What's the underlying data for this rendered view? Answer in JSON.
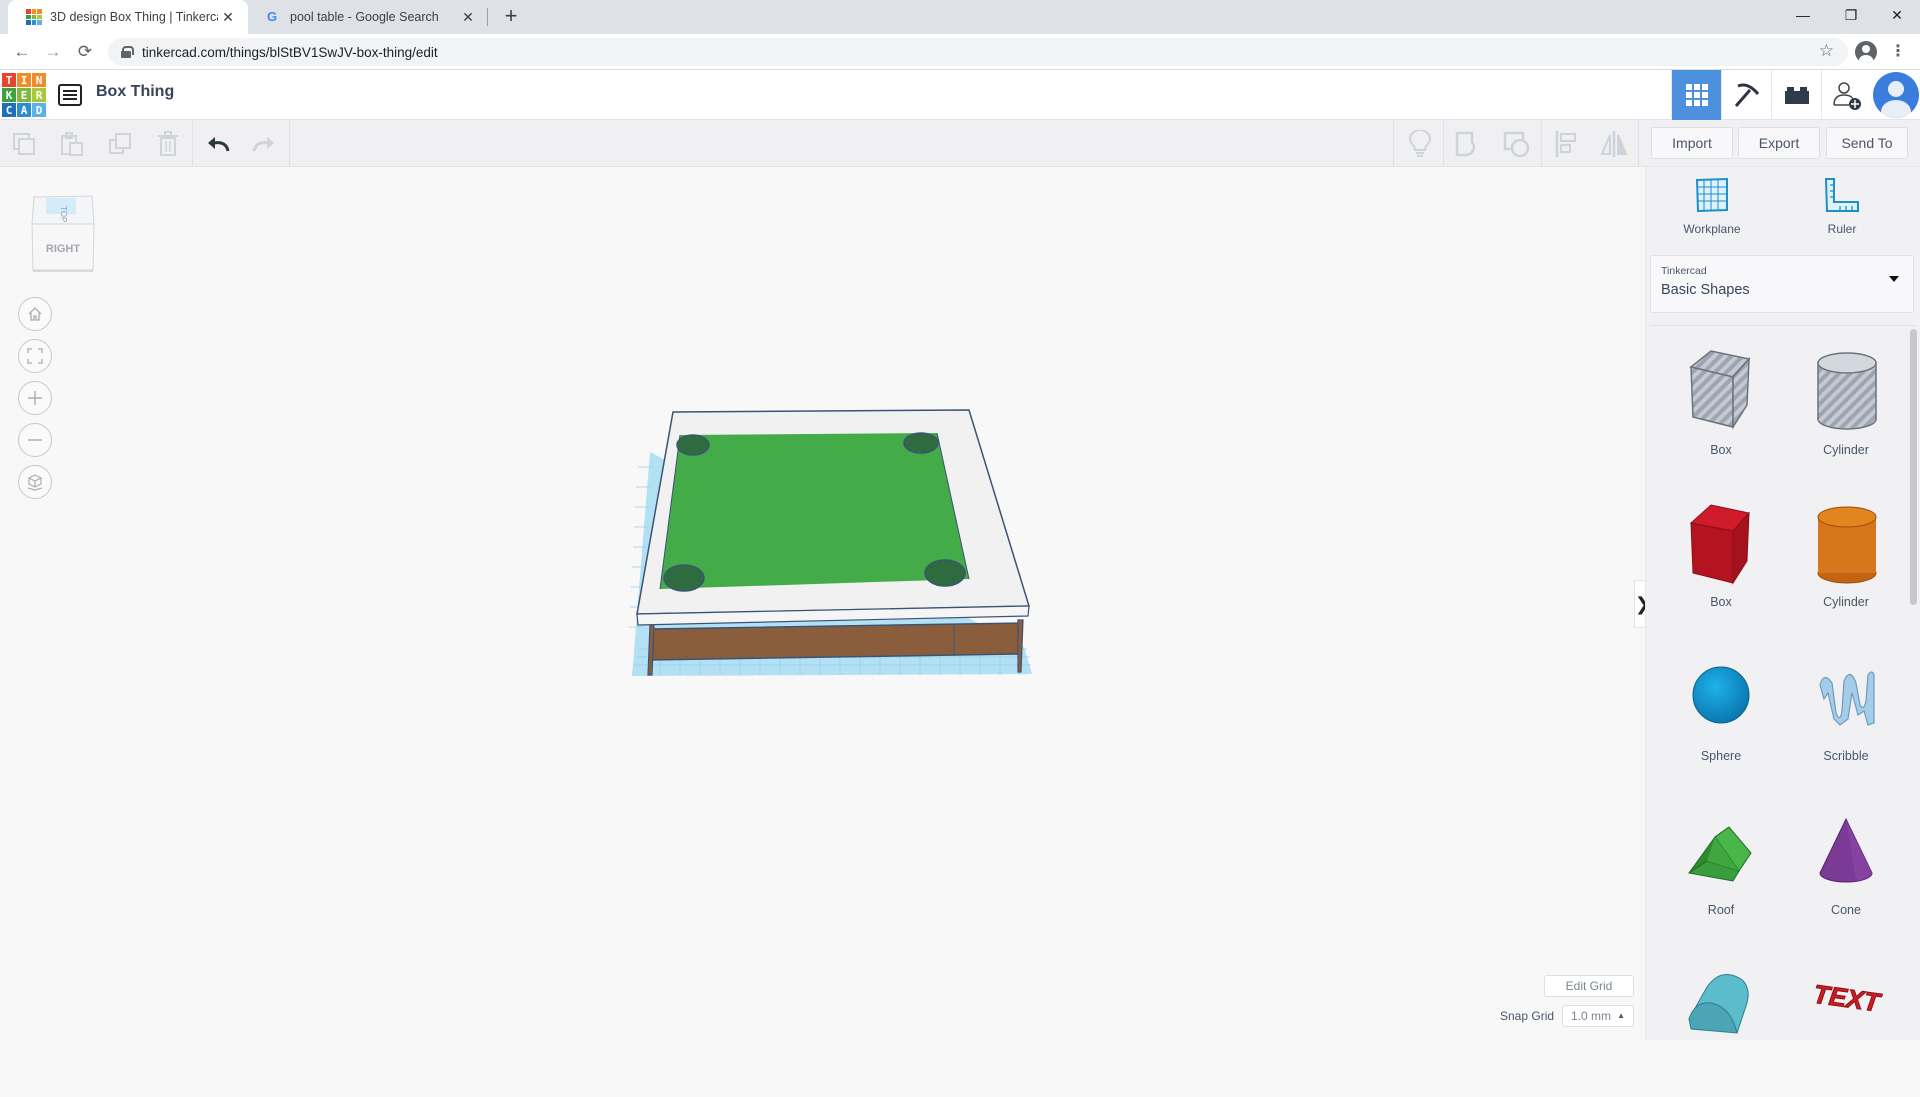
{
  "browser": {
    "tabs": [
      {
        "title": "3D design Box Thing | Tinkercad",
        "active": true,
        "favicon": "tinkercad-logo-icon"
      },
      {
        "title": "pool table - Google Search",
        "active": false,
        "favicon": "google-g-icon"
      }
    ],
    "new_tab_symbol": "+",
    "close_symbol": "✕",
    "window_controls": {
      "minimize": "—",
      "restore": "❐",
      "close": "✕"
    },
    "url": "tinkercad.com/things/blStBV1SwJV-box-thing/edit",
    "nav": {
      "back": "←",
      "forward": "→",
      "reload": "⟳",
      "star": "☆",
      "menu": "⋮"
    }
  },
  "app": {
    "logo_letters": [
      "T",
      "I",
      "N",
      "K",
      "E",
      "R",
      "C",
      "A",
      "D"
    ],
    "logo_colors": [
      "#e8432d",
      "#f28c28",
      "#f28c28",
      "#3fa142",
      "#81b83a",
      "#a7c93b",
      "#1f6fb5",
      "#2d8fd1",
      "#5bb2e3"
    ],
    "design_title": "Box Thing",
    "header_buttons": [
      {
        "name": "3d-view",
        "icon": "grid-icon",
        "active": true
      },
      {
        "name": "codeblocks",
        "icon": "pickaxe-icon",
        "active": false
      },
      {
        "name": "bricks",
        "icon": "brick-icon",
        "active": false
      },
      {
        "name": "invite",
        "icon": "add-user-icon",
        "active": false
      }
    ],
    "accent_color": "#4d90dd"
  },
  "toolbar": {
    "edit_tools": [
      "copy",
      "paste",
      "duplicate",
      "delete"
    ],
    "undo": "undo",
    "redo": "redo",
    "shape_tools": [
      "note",
      "group",
      "ungroup",
      "align",
      "mirror"
    ],
    "import_label": "Import",
    "export_label": "Export",
    "send_to_label": "Send To"
  },
  "viewport": {
    "viewcube_top": "TOP",
    "viewcube_front": "RIGHT",
    "nav_controls": [
      "home-view",
      "fit-all",
      "zoom-in",
      "zoom-out",
      "perspective-toggle"
    ],
    "edit_grid_label": "Edit Grid",
    "snap_grid_label": "Snap Grid",
    "snap_grid_value": "1.0 mm",
    "collapse_symbol": "❯",
    "model": {
      "felt_color": "#43ac48",
      "rail_color": "#f2f2f2",
      "base_color": "#8a5e3c",
      "pocket_count": 4
    }
  },
  "panel": {
    "workplane_label": "Workplane",
    "ruler_label": "Ruler",
    "library_category": "Tinkercad",
    "library_name": "Basic Shapes",
    "shapes": [
      {
        "label": "Box",
        "kind": "box-hole",
        "color": "#b9bec8"
      },
      {
        "label": "Cylinder",
        "kind": "cylinder-hole",
        "color": "#b9bec8"
      },
      {
        "label": "Box",
        "kind": "box",
        "color": "#c8182a"
      },
      {
        "label": "Cylinder",
        "kind": "cylinder",
        "color": "#e07a1b"
      },
      {
        "label": "Sphere",
        "kind": "sphere",
        "color": "#1a9ad6"
      },
      {
        "label": "Scribble",
        "kind": "scribble",
        "color": "#a6cde8"
      },
      {
        "label": "Roof",
        "kind": "roof",
        "color": "#3ea43f"
      },
      {
        "label": "Cone",
        "kind": "cone",
        "color": "#7a3a96"
      },
      {
        "label": "",
        "kind": "round-roof",
        "color": "#5bbccc"
      },
      {
        "label": "",
        "kind": "text",
        "color": "#d01c22"
      }
    ]
  }
}
